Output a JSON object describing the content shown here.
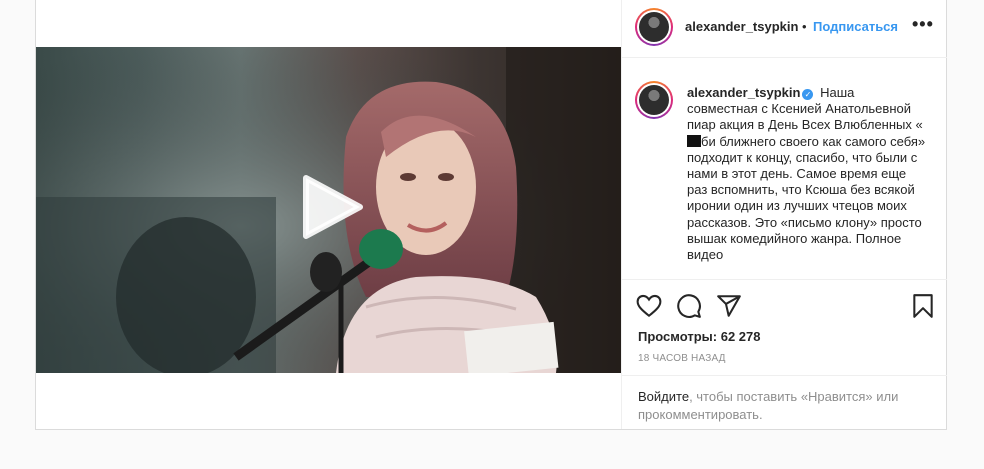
{
  "post": {
    "author": {
      "username": "alexander_tsypkin",
      "verified": true
    },
    "header": {
      "separator": "•",
      "follow_label": "Подписаться",
      "more_label": "•••"
    },
    "caption": {
      "username": "alexander_tsypkin",
      "text_line1": "Наша",
      "text_main_before_censor": "совместная с Ксенией Анатольевной пиар акция в День Всех Влюбленных «",
      "text_main_after_censor": "би ближнего своего как самого себя» подходит к концу, спасибо, что были с нами в этот день. Самое время еще раз вспомнить, что Ксюша без всякой иронии один из лучших чтецов моих рассказов. Это «письмо клону» просто вышак комедийного жанра. Полное видео"
    },
    "stats": {
      "views_label": "Просмотры:",
      "views_count": "62 278",
      "time_ago": "18 часов назад"
    },
    "login_prompt": {
      "link": "Войдите",
      "rest": ", чтобы поставить «Нравится» или прокомментировать."
    },
    "icons": {
      "like": "heart-icon",
      "comment": "comment-icon",
      "share": "share-icon",
      "save": "bookmark-icon",
      "play": "play-icon",
      "verified": "verified-badge-icon"
    },
    "colors": {
      "accent": "#3897f0",
      "text": "#262626",
      "muted": "#8e8e8e",
      "border": "#dbdbdb"
    }
  }
}
